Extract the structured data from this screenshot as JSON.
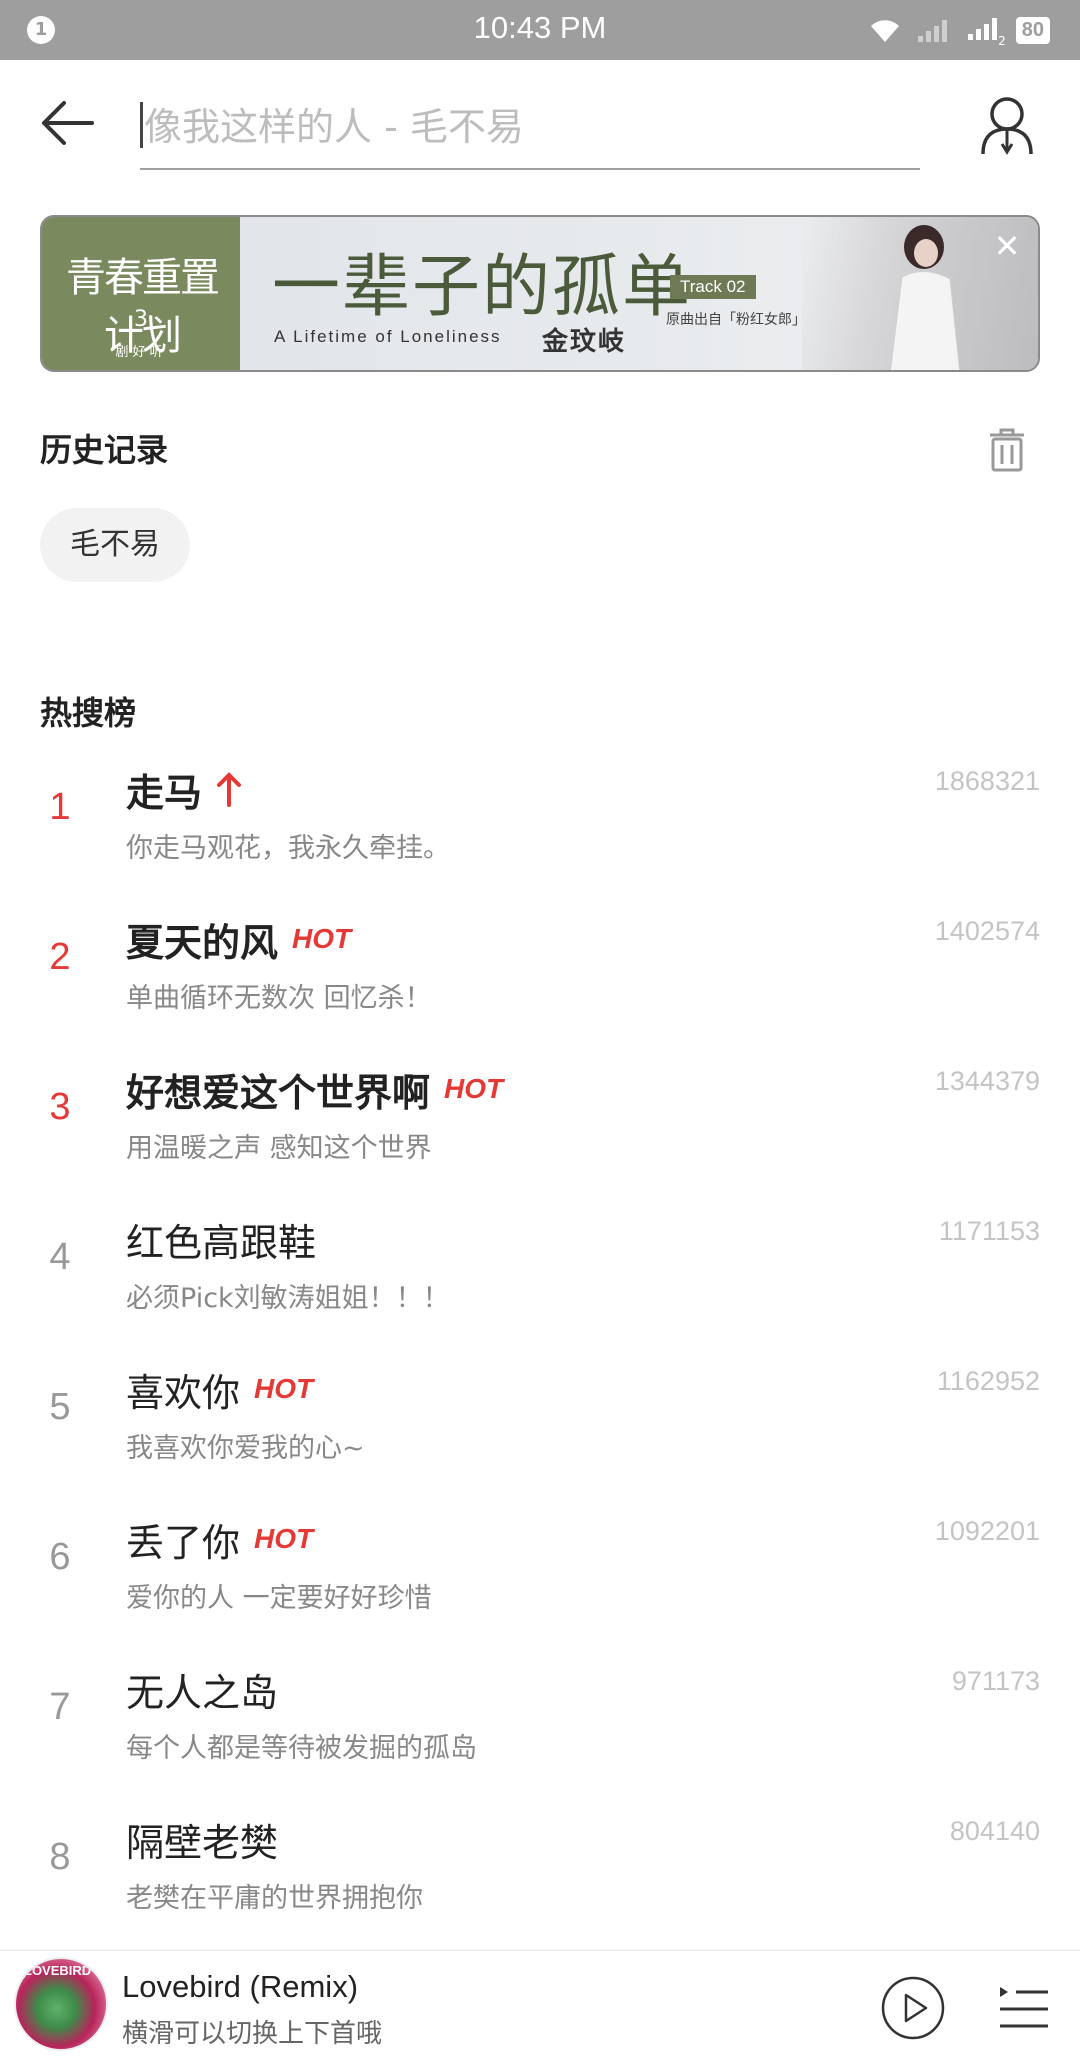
{
  "status_bar": {
    "notification_count": "1",
    "time": "10:43 PM",
    "sim2_label": "2",
    "battery": "80"
  },
  "search": {
    "placeholder": "像我这样的人 - 毛不易"
  },
  "banner": {
    "left_title": "青春重置计划",
    "left_part": "3",
    "left_sub": "剧好听",
    "title": "一辈子的孤单",
    "subtitle": "A Lifetime of Loneliness",
    "artist": "金玟岐",
    "track": "Track 02",
    "source": "原曲出自「粉红女郎」",
    "close_glyph": "✕"
  },
  "history": {
    "title": "历史记录",
    "items": [
      "毛不易"
    ]
  },
  "hot_search": {
    "title": "热搜榜",
    "items": [
      {
        "rank": "1",
        "name": "走马",
        "desc": "你走马观花，我永久牵挂。",
        "count": "1868321",
        "badge": "up",
        "top": true
      },
      {
        "rank": "2",
        "name": "夏天的风",
        "desc": "单曲循环无数次 回忆杀！",
        "count": "1402574",
        "badge": "HOT",
        "top": true
      },
      {
        "rank": "3",
        "name": "好想爱这个世界啊",
        "desc": "用温暖之声 感知这个世界",
        "count": "1344379",
        "badge": "HOT",
        "top": true
      },
      {
        "rank": "4",
        "name": "红色高跟鞋",
        "desc": "必须Pick刘敏涛姐姐！！！",
        "count": "1171153",
        "badge": "",
        "top": false
      },
      {
        "rank": "5",
        "name": "喜欢你",
        "desc": "我喜欢你爱我的心~",
        "count": "1162952",
        "badge": "HOT",
        "top": false
      },
      {
        "rank": "6",
        "name": "丢了你",
        "desc": "爱你的人 一定要好好珍惜",
        "count": "1092201",
        "badge": "HOT",
        "top": false
      },
      {
        "rank": "7",
        "name": "无人之岛",
        "desc": "每个人都是等待被发掘的孤岛",
        "count": "971173",
        "badge": "",
        "top": false
      },
      {
        "rank": "8",
        "name": "隔壁老樊",
        "desc": "老樊在平庸的世界拥抱你",
        "count": "804140",
        "badge": "",
        "top": false
      }
    ]
  },
  "player": {
    "album_label": "LOVEBIRD",
    "title": "Lovebird (Remix)",
    "subtitle": "横滑可以切换上下首哦"
  },
  "colors": {
    "accent_red": "#e53935",
    "status_bar": "#9e9e9e",
    "banner_green": "#7a8a5e"
  }
}
